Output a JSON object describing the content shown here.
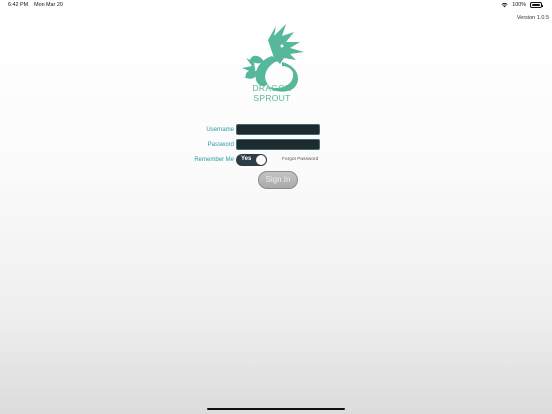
{
  "status_bar": {
    "time": "6:42 PM",
    "date": "Mon Mar 20",
    "wifi_icon": "wifi-icon",
    "battery_percent": "100%",
    "battery_icon": "battery-full-icon"
  },
  "version": "Version 1.0.5",
  "logo": {
    "icon": "dragon-logo-icon",
    "brand_line1": "DRAGON",
    "brand_line2": "SPROUT",
    "color": "#56b79a"
  },
  "form": {
    "username_label": "Username",
    "username_value": "",
    "password_label": "Password",
    "password_value": "",
    "remember_label": "Remember Me",
    "remember_toggle_label": "Yes",
    "remember_on": true,
    "forgot_password": "Forgot Password",
    "sign_in": "Sign In",
    "label_color": "#2a9aa0"
  }
}
